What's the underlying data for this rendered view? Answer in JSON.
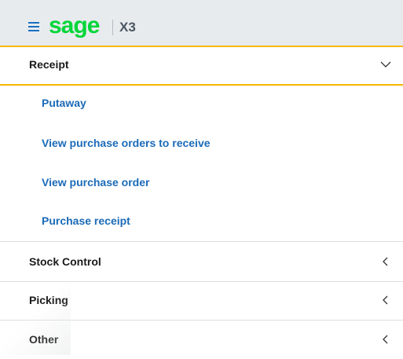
{
  "header": {
    "menu_icon": "hamburger-menu-icon",
    "logo": "sage",
    "product": "X3",
    "brand_color": "#00d639"
  },
  "menu": {
    "sections": [
      {
        "label": "Receipt",
        "expanded": true,
        "icon": "chevron-down-icon",
        "items": [
          "Putaway",
          "View purchase orders to receive",
          "View purchase order",
          "Purchase receipt"
        ]
      },
      {
        "label": "Stock Control",
        "expanded": false,
        "icon": "chevron-left-icon"
      },
      {
        "label": "Picking",
        "expanded": false,
        "icon": "chevron-left-icon"
      },
      {
        "label": "Other",
        "expanded": false,
        "icon": "chevron-left-icon"
      }
    ],
    "accent_color": "#f6b800",
    "link_color": "#1b6bb8"
  }
}
